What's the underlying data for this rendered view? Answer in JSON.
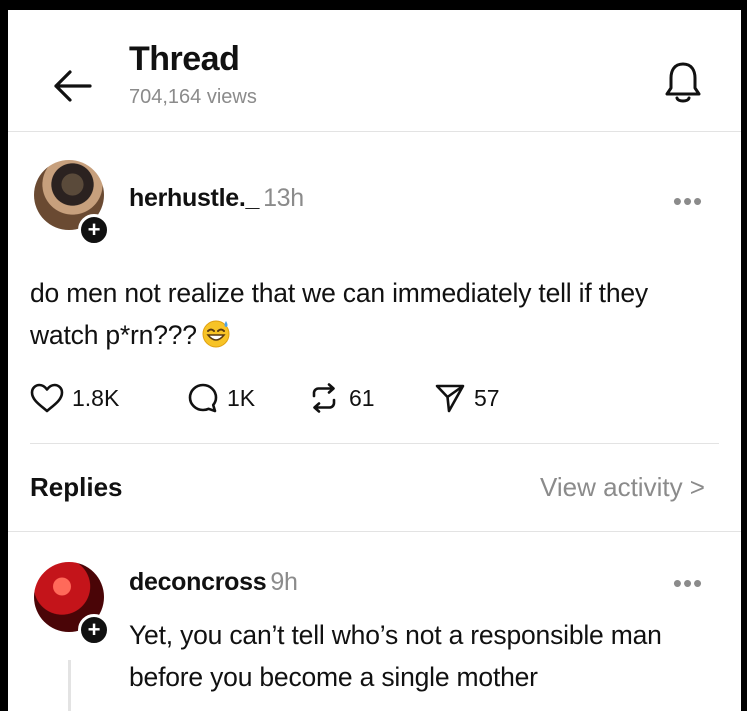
{
  "header": {
    "title": "Thread",
    "views": "704,164 views",
    "back_icon": "arrow-left-icon",
    "bell_icon": "bell-icon"
  },
  "post": {
    "username": "herhustle._",
    "time": "13h",
    "text": "do men not realize that we can immediately tell if they watch p*rn???",
    "emoji": "grinning-face-with-sweat",
    "more_icon": "more-dots-icon",
    "actions": {
      "likes": "1.8K",
      "comments": "1K",
      "reposts": "61",
      "shares": "57"
    }
  },
  "replies_section": {
    "label": "Replies",
    "view_activity": "View activity >"
  },
  "reply": {
    "username": "deconcross",
    "time": "9h",
    "text": "Yet, you can’t tell who’s not a responsible man before you become a single mother"
  },
  "colors": {
    "text": "#111111",
    "muted": "#8b8b8b",
    "divider": "#e3e3e3",
    "background": "#ffffff",
    "frame": "#000000"
  }
}
